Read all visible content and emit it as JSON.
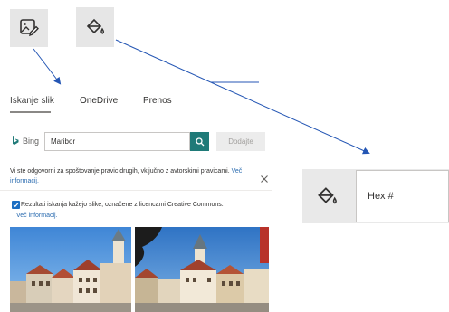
{
  "tabs": [
    {
      "label": "Iskanje slik",
      "active": true
    },
    {
      "label": "OneDrive",
      "active": false
    },
    {
      "label": "Prenos",
      "active": false
    }
  ],
  "search": {
    "brand": "Bing",
    "value": "Maribor",
    "add_label": "Dodajte"
  },
  "notice": {
    "text": "Vi ste odgovorni za spoštovanje pravic drugih, vključno z avtorskimi pravicami.",
    "link": "Več informacij."
  },
  "license": {
    "text": "Rezultati iskanja kažejo slike, označene z licencami Creative Commons.",
    "link": "Več informacij."
  },
  "hex_panel": {
    "label": "Hex #",
    "value": ""
  },
  "colors": {
    "accent": "#1f7a78",
    "arrow": "#2456b4",
    "link": "#2b6cb0",
    "checkbox": "#1b6ec2"
  },
  "icons": {
    "picture_edit": "image-edit-icon",
    "fill_color": "paint-bucket-icon"
  }
}
